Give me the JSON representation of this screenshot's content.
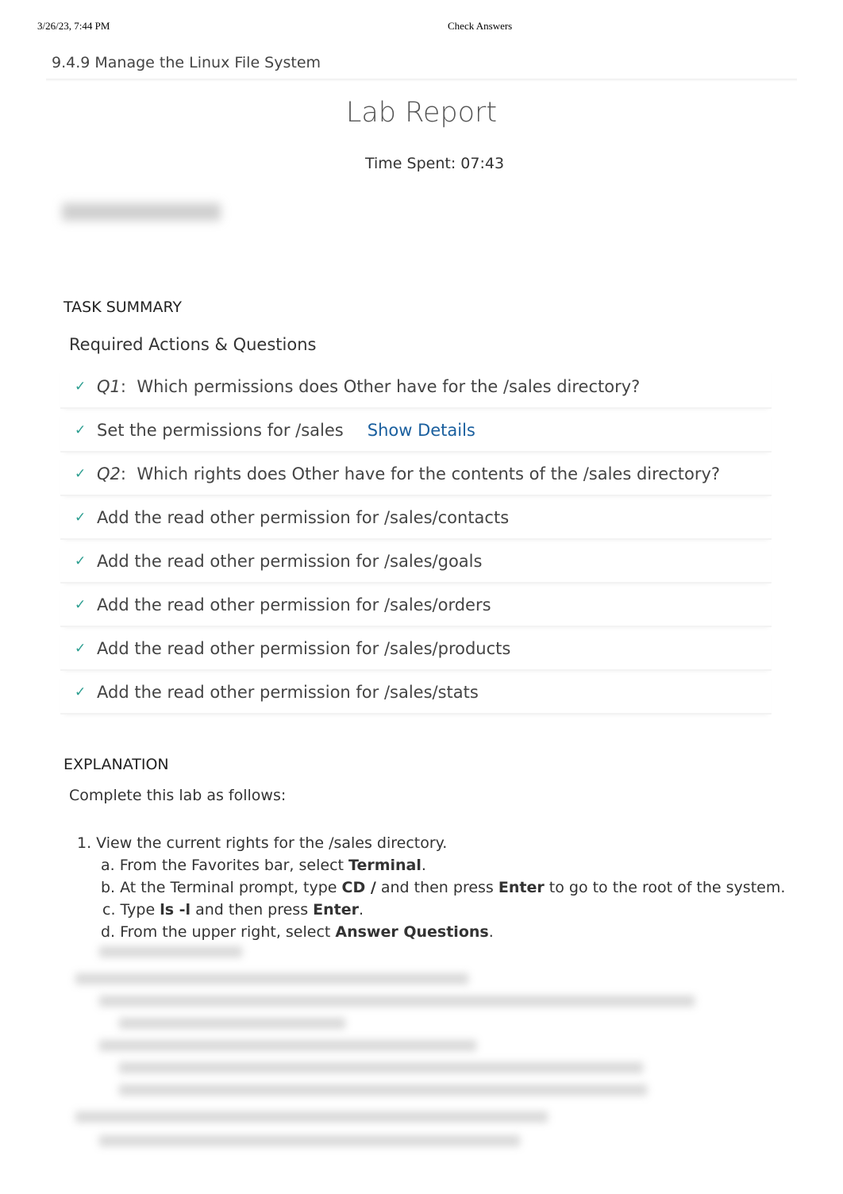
{
  "header": {
    "datetime": "3/26/23, 7:44 PM",
    "page_title": "Check Answers"
  },
  "course": "9.4.9 Manage the Linux File System",
  "report": {
    "title": "Lab Report",
    "time_spent": "Time Spent: 07:43"
  },
  "task_summary": {
    "heading": "TASK SUMMARY",
    "subheading": "Required Actions & Questions",
    "show_details": "Show Details",
    "items": [
      {
        "prefix": "Q1",
        "text": "Which permissions does Other have for the /sales directory?"
      },
      {
        "prefix": "",
        "text": "Set the permissions for /sales"
      },
      {
        "prefix": "Q2",
        "text": "Which rights does Other have for the contents of the /sales directory?"
      },
      {
        "prefix": "",
        "text": "Add the read other permission for /sales/contacts"
      },
      {
        "prefix": "",
        "text": "Add the read other permission for /sales/goals"
      },
      {
        "prefix": "",
        "text": "Add the read other permission for /sales/orders"
      },
      {
        "prefix": "",
        "text": "Add the read other permission for /sales/products"
      },
      {
        "prefix": "",
        "text": "Add the read other permission for /sales/stats"
      }
    ]
  },
  "explanation": {
    "heading": "EXPLANATION",
    "intro": "Complete this lab as follows:",
    "step1": "1. View the current rights for the /sales directory.",
    "a": [
      "a. From the Favorites bar, select ",
      "Terminal",
      "."
    ],
    "b": [
      "b. At the Terminal prompt, type ",
      "CD /",
      " and then press ",
      "Enter",
      " to go to the root of the system."
    ],
    "c": [
      "c. Type ",
      "ls -l",
      " and then press ",
      "Enter",
      "."
    ],
    "d": [
      "d. From the upper right, select ",
      "Answer Questions",
      "."
    ]
  }
}
